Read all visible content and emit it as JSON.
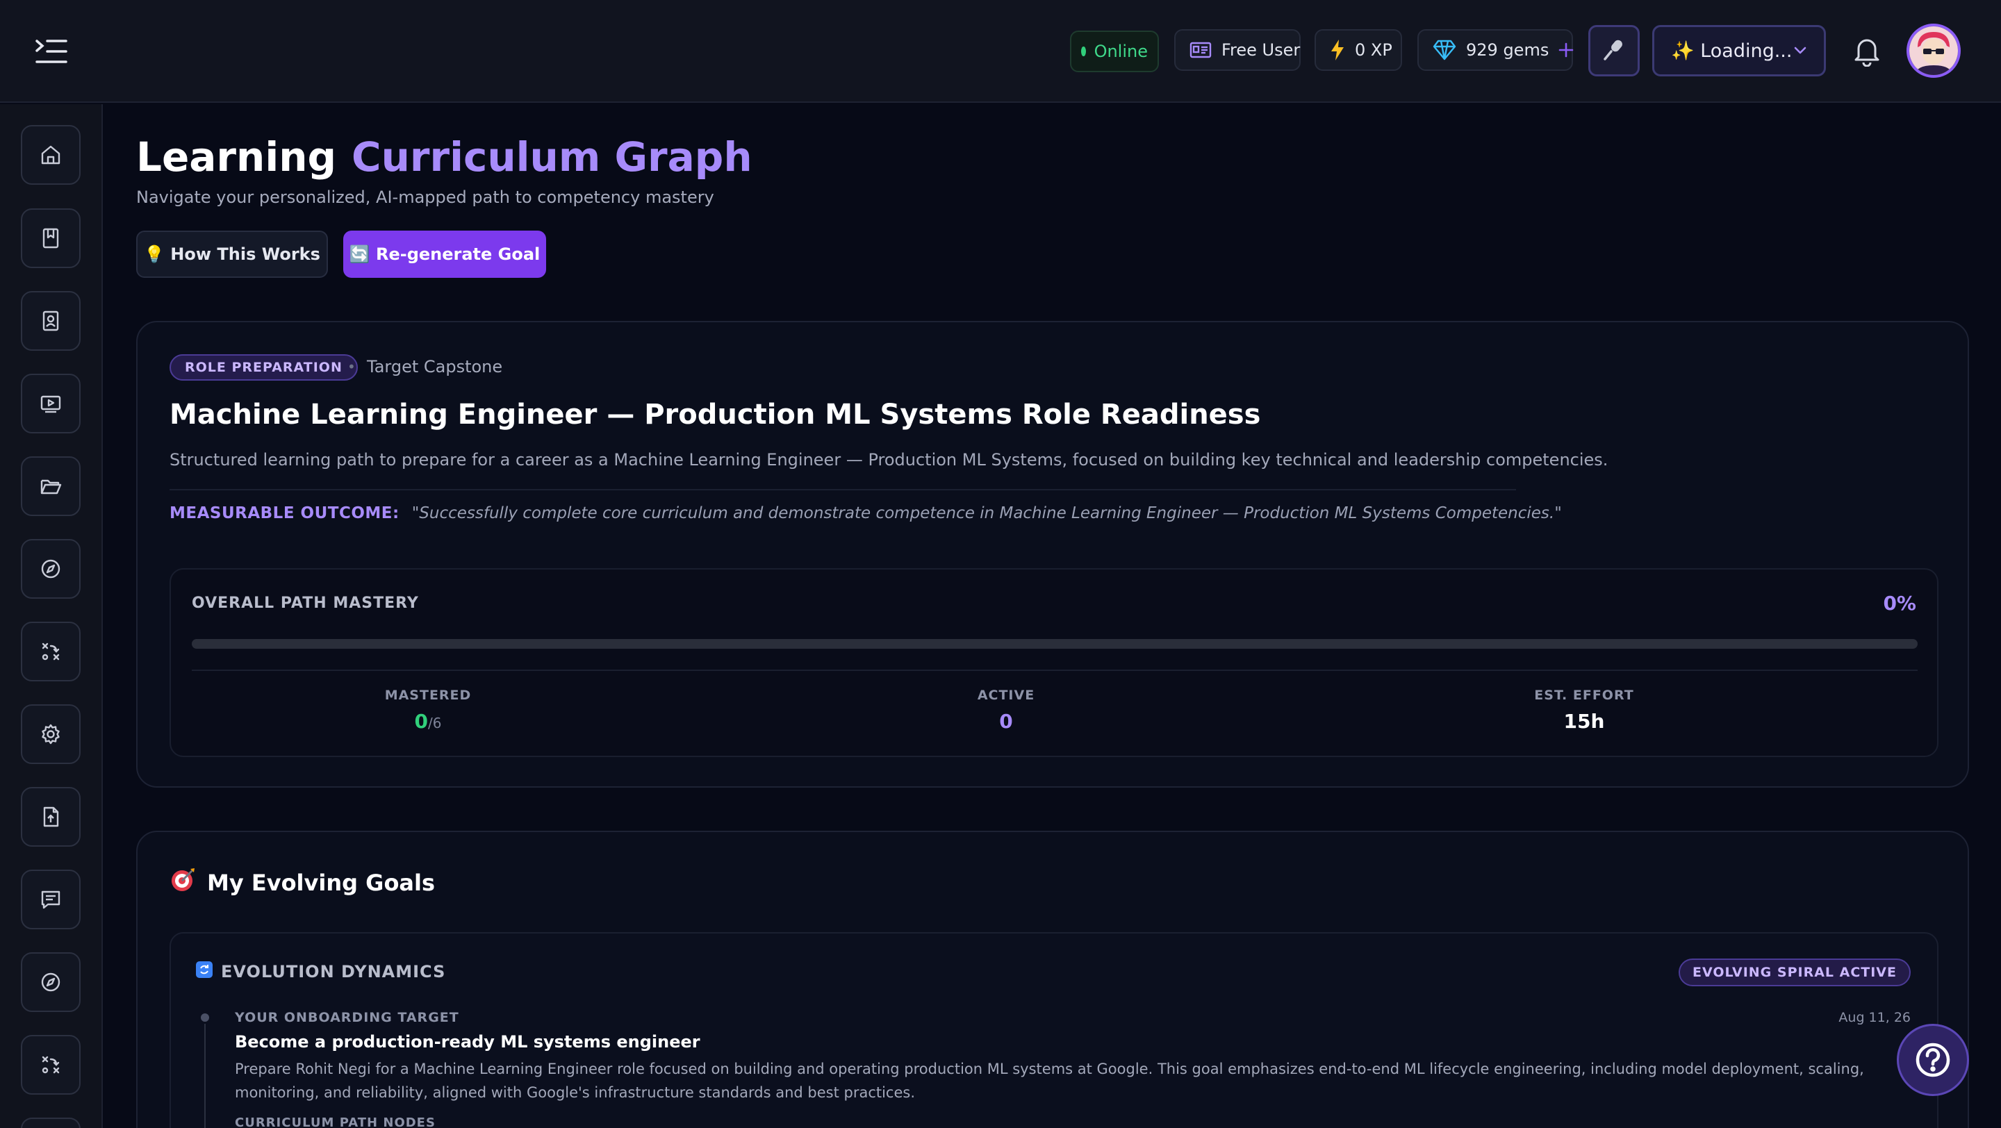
{
  "header": {
    "status": "Online",
    "plan": "Free User",
    "xp": "0 XP",
    "gems": "929 gems",
    "model_selector": "✨ Loading..."
  },
  "page": {
    "title_part1": "Learning",
    "title_part2": "Curriculum Graph",
    "subtitle": "Navigate your personalized, AI-mapped path to competency mastery",
    "how_button": "💡 How This Works",
    "regen_button": "🔄 Re-generate Goal"
  },
  "goal_card": {
    "badge": "ROLE PREPARATION",
    "tag": "Target Capstone",
    "title": "Machine Learning Engineer — Production ML Systems Role Readiness",
    "description": "Structured learning path to prepare for a career as a Machine Learning Engineer — Production ML Systems, focused on building key technical and leadership competencies.",
    "outcome_label": "MEASURABLE OUTCOME:",
    "outcome_text": "\"Successfully complete core curriculum and demonstrate competence in Machine Learning Engineer — Production ML Systems Competencies.\"",
    "mastery": {
      "label": "OVERALL PATH MASTERY",
      "percent_text": "0%",
      "percent": 0,
      "stats": {
        "mastered_label": "MASTERED",
        "mastered_value": "0",
        "mastered_total": "/6",
        "active_label": "ACTIVE",
        "active_value": "0",
        "effort_label": "EST. EFFORT",
        "effort_value": "15h"
      }
    }
  },
  "goals_section": {
    "title": "My Evolving Goals",
    "evolution": {
      "title": "EVOLUTION DYNAMICS",
      "badge": "EVOLVING SPIRAL ACTIVE",
      "target_label": "YOUR ONBOARDING TARGET",
      "date": "Aug 11, 26",
      "goal": "Become a production-ready ML systems engineer",
      "description": "Prepare Rohit Negi for a Machine Learning Engineer role focused on building and operating production ML systems at Google. This goal emphasizes end-to-end ML lifecycle engineering, including model deployment, scaling, monitoring, and reliability, aligned with Google's infrastructure standards and best practices.",
      "nodes_label": "CURRICULUM PATH NODES"
    }
  },
  "colors": {
    "accent": "#7c3aed",
    "accent_light": "#a78bfa",
    "success": "#31d07b",
    "background": "#070a17"
  }
}
